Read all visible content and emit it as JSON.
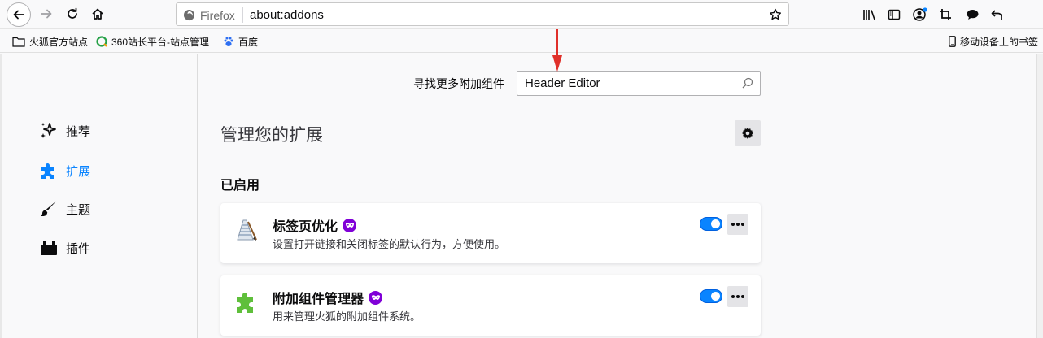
{
  "toolbar": {
    "identity_label": "Firefox",
    "url": "about:addons"
  },
  "bookmarks": {
    "items": [
      {
        "label": "火狐官方站点",
        "icon": "folder-icon"
      },
      {
        "label": "360站长平台-站点管理",
        "icon": "site-icon"
      },
      {
        "label": "百度",
        "icon": "baidu-paw-icon"
      }
    ],
    "mobile_label": "移动设备上的书签"
  },
  "sidebar": {
    "items": [
      {
        "label": "推荐",
        "icon": "sparkle-icon",
        "active": false
      },
      {
        "label": "扩展",
        "icon": "puzzle-icon",
        "active": true
      },
      {
        "label": "主题",
        "icon": "brush-icon",
        "active": false
      },
      {
        "label": "插件",
        "icon": "plugin-icon",
        "active": false
      }
    ]
  },
  "search": {
    "label": "寻找更多附加组件",
    "value": "Header Editor"
  },
  "main": {
    "title": "管理您的扩展",
    "section_enabled": "已启用",
    "addons": [
      {
        "name": "标签页优化",
        "description": "设置打开链接和关闭标签的默认行为，方便使用。",
        "enabled": true
      },
      {
        "name": "附加组件管理器",
        "description": "用来管理火狐的附加组件系统。",
        "enabled": true
      }
    ]
  },
  "colors": {
    "accent": "#0a84ff",
    "badge": "#8000d7",
    "annotation": "#e0302a"
  }
}
